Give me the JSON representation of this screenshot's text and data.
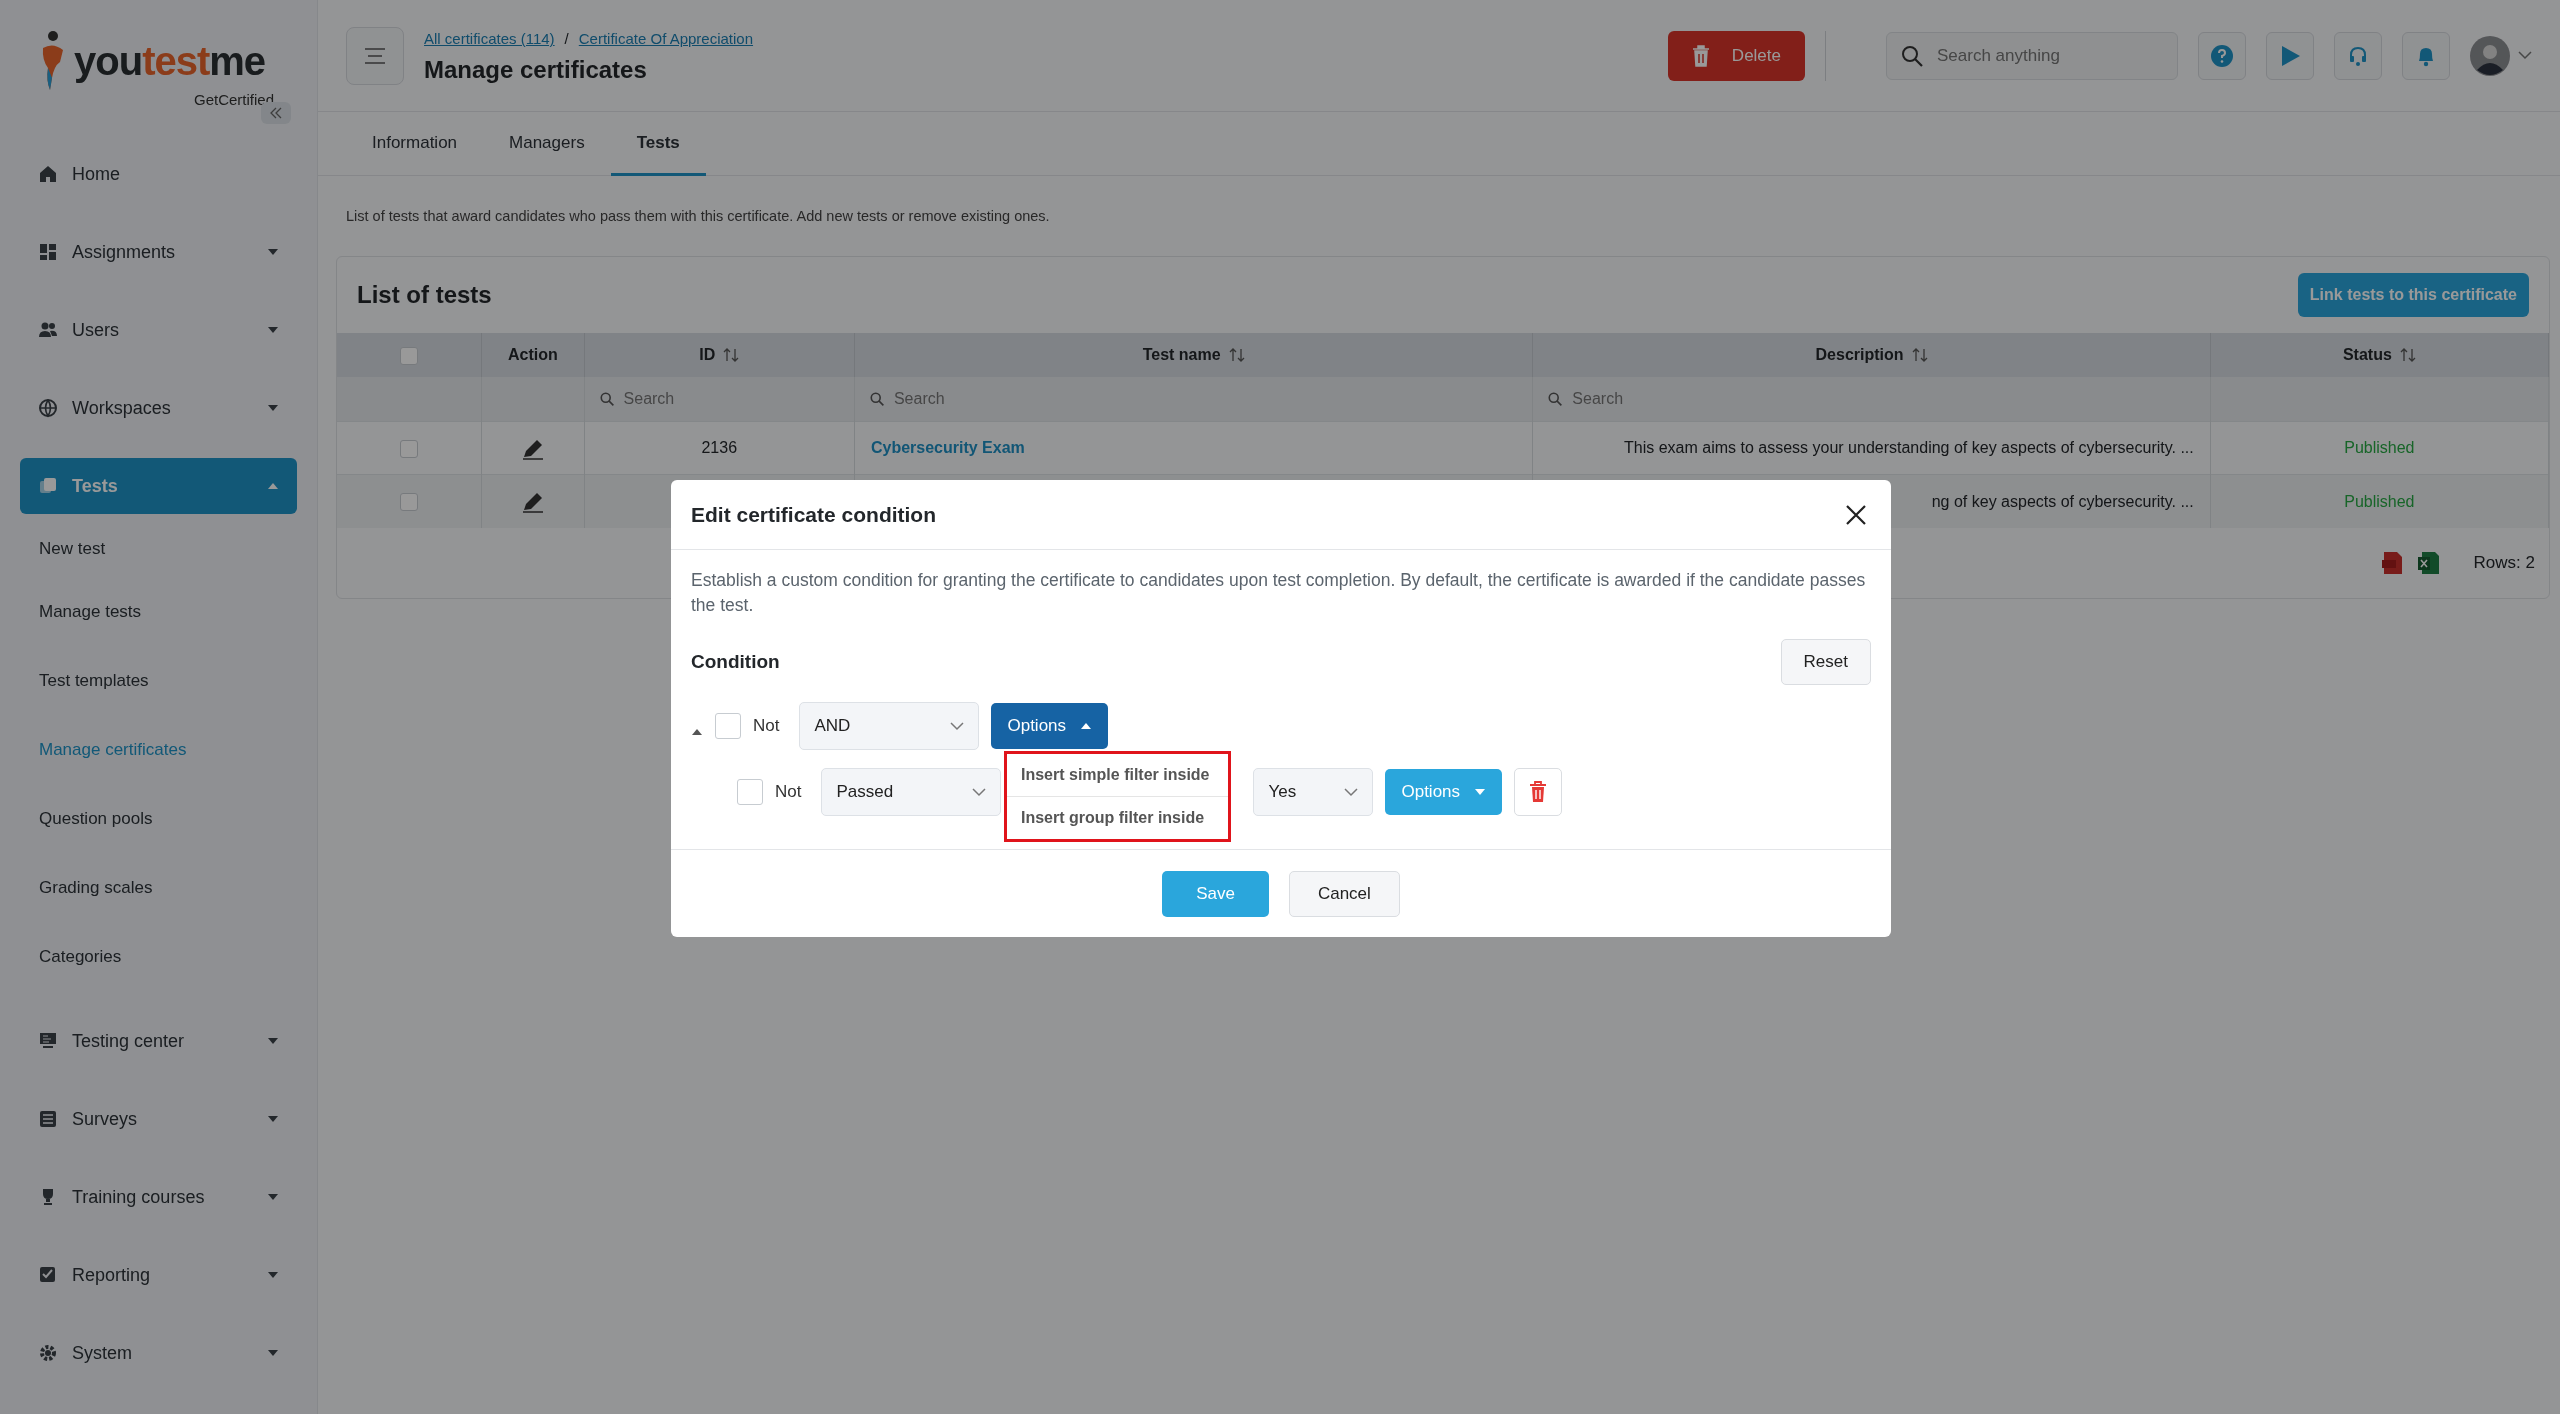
{
  "logo": {
    "parts": [
      "you",
      "test",
      "me"
    ],
    "tagline": "GetCertified"
  },
  "sidebar": {
    "items": [
      {
        "label": "Home",
        "selected": false
      },
      {
        "label": "Assignments",
        "selected": false,
        "expanded": false
      },
      {
        "label": "Users",
        "selected": false,
        "expanded": false
      },
      {
        "label": "Workspaces",
        "selected": false,
        "expanded": false
      },
      {
        "label": "Tests",
        "selected": true,
        "expanded": true,
        "children": [
          {
            "label": "New test",
            "selected": false
          },
          {
            "label": "Manage tests",
            "selected": false
          },
          {
            "label": "Test templates",
            "selected": false
          },
          {
            "label": "Manage certificates",
            "selected": true
          },
          {
            "label": "Question pools",
            "selected": false
          },
          {
            "label": "Grading scales",
            "selected": false
          },
          {
            "label": "Categories",
            "selected": false
          }
        ]
      },
      {
        "label": "Testing center",
        "selected": false,
        "expanded": false
      },
      {
        "label": "Surveys",
        "selected": false,
        "expanded": false
      },
      {
        "label": "Training courses",
        "selected": false,
        "expanded": false
      },
      {
        "label": "Reporting",
        "selected": false,
        "expanded": false
      },
      {
        "label": "System",
        "selected": false,
        "expanded": false
      }
    ]
  },
  "header": {
    "breadcrumbs": [
      "All certificates (114)",
      "Certificate Of Appreciation"
    ],
    "separator": "/",
    "title": "Manage certificates",
    "delete_button": "Delete",
    "search": {
      "placeholder": "Search anything"
    }
  },
  "tabs": [
    {
      "label": "Information",
      "selected": false
    },
    {
      "label": "Managers",
      "selected": false
    },
    {
      "label": "Tests",
      "selected": true
    }
  ],
  "intro": "List of tests that award candidates who pass them with this certificate. Add new tests or remove existing ones.",
  "card": {
    "title": "List of tests",
    "link_button": "Link tests to this certificate"
  },
  "table": {
    "header_checked": false,
    "columns": [
      {
        "label": "Action",
        "sortable": false
      },
      {
        "label": "ID",
        "sortable": true,
        "filter_placeholder": "Search"
      },
      {
        "label": "Test name",
        "sortable": true,
        "filter_placeholder": "Search"
      },
      {
        "label": "Description",
        "sortable": true,
        "filter_placeholder": "Search"
      },
      {
        "label": "Status",
        "sortable": true
      }
    ],
    "rows": [
      {
        "checked": false,
        "id": "2136",
        "name": "Cybersecurity Exam",
        "description": "This exam aims to assess your understanding of key aspects of cybersecurity. ...",
        "status": "Published"
      },
      {
        "checked": false,
        "description": "ng of key aspects of cybersecurity. ...",
        "status": "Published"
      }
    ],
    "rows_label": "Rows: 2"
  },
  "modal": {
    "title": "Edit certificate condition",
    "description": "Establish a custom condition for granting the certificate to candidates upon test completion. By default, the certificate is awarded if the candidate passes the test.",
    "condition_label": "Condition",
    "reset": "Reset",
    "group": {
      "expanded": true,
      "not_checked": false,
      "not_label": "Not",
      "operator": "AND",
      "options": "Options",
      "menu_open": true,
      "menu": [
        "Insert simple filter inside",
        "Insert group filter inside"
      ],
      "children": [
        {
          "not_checked": false,
          "not_label": "Not",
          "field": "Passed",
          "value": "Yes",
          "options": "Options",
          "menu_open": false
        }
      ]
    },
    "buttons": [
      {
        "label": "Save",
        "kind": "primary"
      },
      {
        "label": "Cancel",
        "kind": "secondary"
      }
    ]
  }
}
